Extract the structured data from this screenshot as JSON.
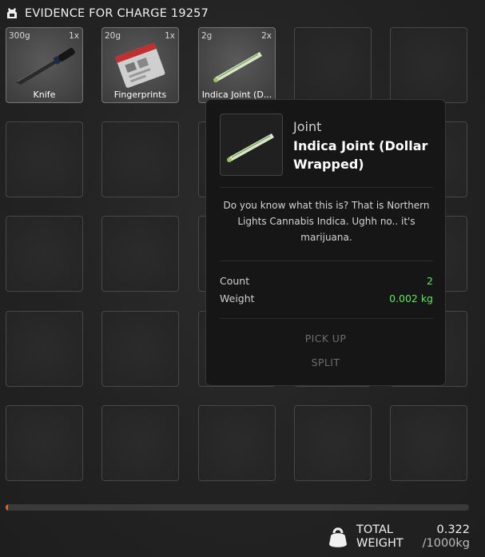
{
  "header": {
    "title": "EVIDENCE FOR CHARGE 19257",
    "icon": "evidence-bag-icon"
  },
  "grid_items": [
    {
      "weight": "300g",
      "quantity": "1x",
      "name": "Knife",
      "icon": "knife-icon"
    },
    {
      "weight": "20g",
      "quantity": "1x",
      "name": "Fingerprints",
      "icon": "fingerprint-bag-icon"
    },
    {
      "weight": "2g",
      "quantity": "2x",
      "name": "Indica Joint (D...",
      "icon": "joint-icon"
    }
  ],
  "tooltip": {
    "category": "Joint",
    "title": "Indica Joint (Dollar Wrapped)",
    "description": "Do you know what this is? That is Northern Lights Cannabis Indica. Ughh no.. it's marijuana.",
    "stats": [
      {
        "label": "Count",
        "value": "2"
      },
      {
        "label": "Weight",
        "value": "0.002 kg"
      }
    ],
    "actions": [
      "PICK UP",
      "SPLIT"
    ],
    "stat_color": "#5ee65e"
  },
  "footer": {
    "total_label_line1": "TOTAL",
    "total_label_line2": "WEIGHT",
    "total_value": "0.322",
    "max_value": "/1000kg",
    "fill_fraction": 0.000322,
    "bar_color": "#d36b2a"
  }
}
